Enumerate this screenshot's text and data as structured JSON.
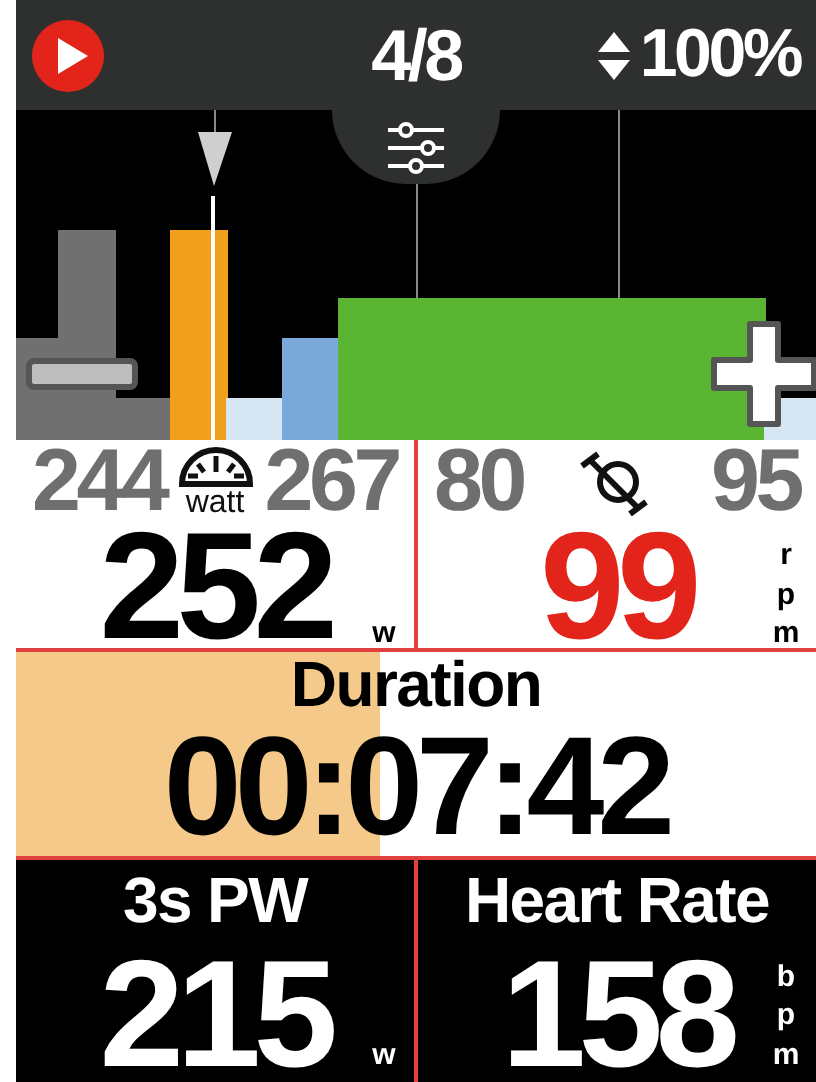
{
  "header": {
    "page": "4/8",
    "zoom": "100%"
  },
  "fields": [
    {
      "kind": "power",
      "low": "244",
      "icon_label": "watt",
      "high": "267",
      "value": "252",
      "unit": "w",
      "alert": false
    },
    {
      "kind": "cadence",
      "low": "80",
      "high": "95",
      "value": "99",
      "unit": "rpm",
      "alert": true
    }
  ],
  "duration": {
    "label": "Duration",
    "value": "00:07:42",
    "level": 0.455
  },
  "bottom_fields": [
    {
      "label": "3s PW",
      "value": "215",
      "unit": "w"
    },
    {
      "label": "Heart Rate",
      "value": "158",
      "unit": "bpm"
    }
  ]
}
